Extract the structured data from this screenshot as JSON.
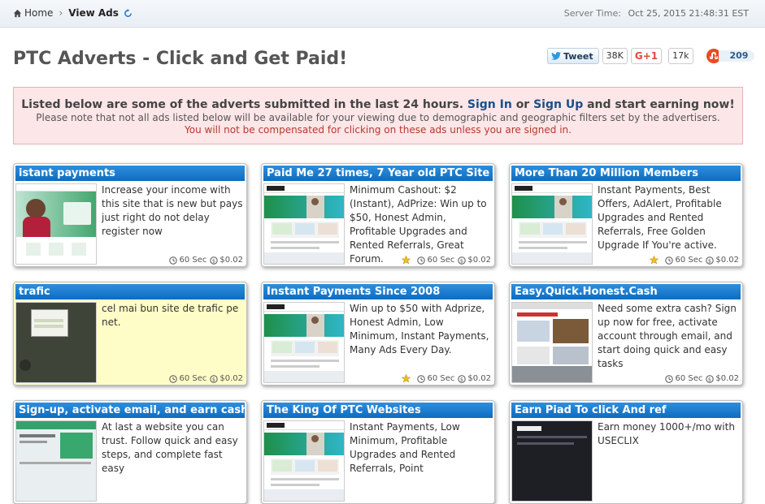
{
  "breadcrumb": {
    "home_label": "Home",
    "current_label": "View Ads"
  },
  "server_time": {
    "label": "Server Time:",
    "value": "Oct 25, 2015 21:48:31 EST"
  },
  "page_title": "PTC Adverts - Click and Get Paid!",
  "share": {
    "tweet_label": "Tweet",
    "tweet_count": "38K",
    "gplus_label": "G+1",
    "gplus_count": "17k",
    "stumble_count": "209"
  },
  "notice": {
    "line1_before": "Listed below are some of the adverts submitted in the last 24 hours.",
    "sign_in": "Sign In",
    "or": "or",
    "sign_up": "Sign Up",
    "line1_after": "and start earning now!",
    "line2": "Please note that not all ads listed below will be available for your viewing due to demographic and geographic filters set by the advertisers.",
    "line3": "You will not be compensated for clicking on these ads unless you are signed in."
  },
  "colors": {
    "title_bar": "#1a7ad0",
    "highlight": "#fefdc8",
    "notice_bg": "#fde6e8",
    "warning_text": "#b33a2d",
    "link": "#1a4f87"
  },
  "ads": [
    {
      "title": "istant payments",
      "description": "Increase your income with this site that is new but pays just right do not delay register now",
      "duration": "60 Sec",
      "reward": "$0.02",
      "starred": false,
      "highlighted": false,
      "thumb": "person"
    },
    {
      "title": "Paid Me 27 times, 7 Year old PTC Site",
      "description": "Minimum Cashout: $2 (Instant), AdPrize: Win up to $50, Honest Admin, Profitable Upgrades and Rented Referrals, Great Forum.",
      "duration": "60 Sec",
      "reward": "$0.02",
      "starred": true,
      "highlighted": false,
      "thumb": "neobux"
    },
    {
      "title": "More Than 20 Million Members",
      "description": "Instant Payments, Best Offers, AdAlert, Profitable Upgrades and Rented Referrals, Free Golden Upgrade If You're active.",
      "duration": "60 Sec",
      "reward": "$0.02",
      "starred": true,
      "highlighted": false,
      "thumb": "neobux"
    },
    {
      "title": "trafic",
      "description": "cel mai bun site de trafic pe net.",
      "duration": "60 Sec",
      "reward": "$0.02",
      "starred": false,
      "highlighted": true,
      "thumb": "dark"
    },
    {
      "title": "Instant Payments Since 2008",
      "description": "Win up to $50 with Adprize, Honest Admin, Low Minimum, Instant Payments, Many Ads Every Day.",
      "duration": "60 Sec",
      "reward": "$0.02",
      "starred": true,
      "highlighted": false,
      "thumb": "neobux"
    },
    {
      "title": "Easy.Quick.Honest.Cash",
      "description": "Need some extra cash? Sign up now for free, activate account through email, and start doing quick and easy tasks",
      "duration": "60 Sec",
      "reward": "$0.02",
      "starred": false,
      "highlighted": false,
      "thumb": "tasks"
    },
    {
      "title": "Sign-up, activate email, and earn cash!",
      "description": "At last a website you can trust. Follow quick and easy steps, and complete fast easy",
      "duration": "",
      "reward": "",
      "starred": false,
      "highlighted": false,
      "thumb": "green"
    },
    {
      "title": "The King Of PTC Websites",
      "description": "Instant Payments, Low Minimum, Profitable Upgrades and Rented Referrals, Point",
      "duration": "",
      "reward": "",
      "starred": false,
      "highlighted": false,
      "thumb": "neobux"
    },
    {
      "title": "Earn Piad To click And ref",
      "description": "Earn money 1000+/mo with USECLIX",
      "duration": "",
      "reward": "",
      "starred": false,
      "highlighted": false,
      "thumb": "useclix"
    }
  ]
}
